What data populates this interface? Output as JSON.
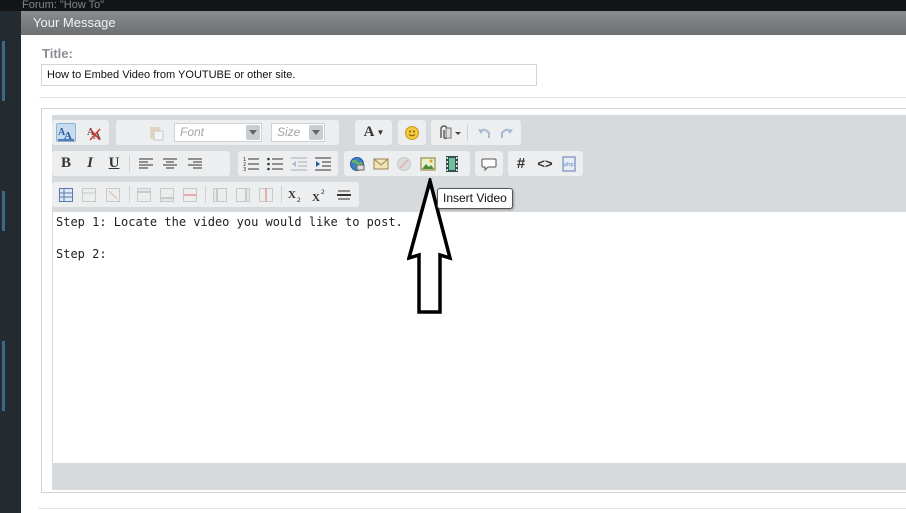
{
  "forum_bar": {
    "text": "Forum: \"How To\""
  },
  "window": {
    "title": "Your Message"
  },
  "form": {
    "title_label": "Title:",
    "title_value": "How to Embed Video from YOUTUBE or other site."
  },
  "toolbar": {
    "font_placeholder": "Font",
    "size_placeholder": "Size",
    "bold": "B",
    "italic": "I",
    "underline": "U",
    "hash": "#",
    "code": "<>",
    "font_color": "A",
    "aa": "A"
  },
  "tooltip": {
    "text": "Insert Video"
  },
  "content": {
    "lines": [
      "Step 1: Locate the video you would like to post.",
      "Step 2:"
    ]
  },
  "colors": {
    "accent": "#3a6a8a",
    "titlebar": "#7b7e81"
  }
}
